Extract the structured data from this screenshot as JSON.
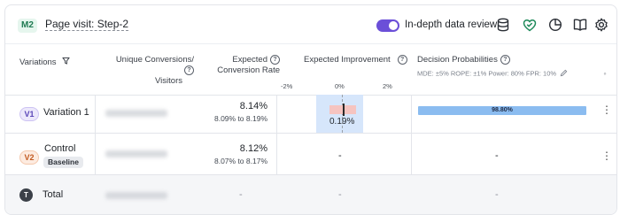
{
  "header": {
    "metric_badge": "M2",
    "goal_title": "Page visit: Step-2",
    "toggle_label": "In-depth data review",
    "toggle_on": true,
    "accent_color": "#6b4fd8",
    "icons": [
      "database-icon",
      "heart-shield-icon",
      "pie-chart-icon",
      "book-icon",
      "gear-icon"
    ]
  },
  "table": {
    "columns": {
      "variations": "Variations",
      "unique_conversions": "Unique Conversions/",
      "visitors": "Visitors",
      "expected_line1": "Expected",
      "expected_line2": "Conversion Rate",
      "expected_improvement": "Expected Improvement",
      "decision_probabilities": "Decision Probabilities",
      "decision_sub": "MDE: ±5%  ROPE: ±1%  Power: 80%  FPR: 10%"
    },
    "improvement_axis": [
      "-2%",
      "0%",
      "2%"
    ],
    "rows": [
      {
        "badge": "V1",
        "name": "Variation 1",
        "rate": "8.14%",
        "ci": "8.09% to 8.19%",
        "improvement": "0.19%",
        "improvement_value": 0.19,
        "probability": "98.80%",
        "probability_value": 98.8
      },
      {
        "badge": "V2",
        "name": "Control",
        "baseline_tag": "Baseline",
        "rate": "8.12%",
        "ci": "8.07% to 8.17%",
        "improvement": "-",
        "probability": "-"
      },
      {
        "badge": "T",
        "name": "Total",
        "rate": "-",
        "improvement": "-",
        "probability": "-"
      }
    ]
  }
}
